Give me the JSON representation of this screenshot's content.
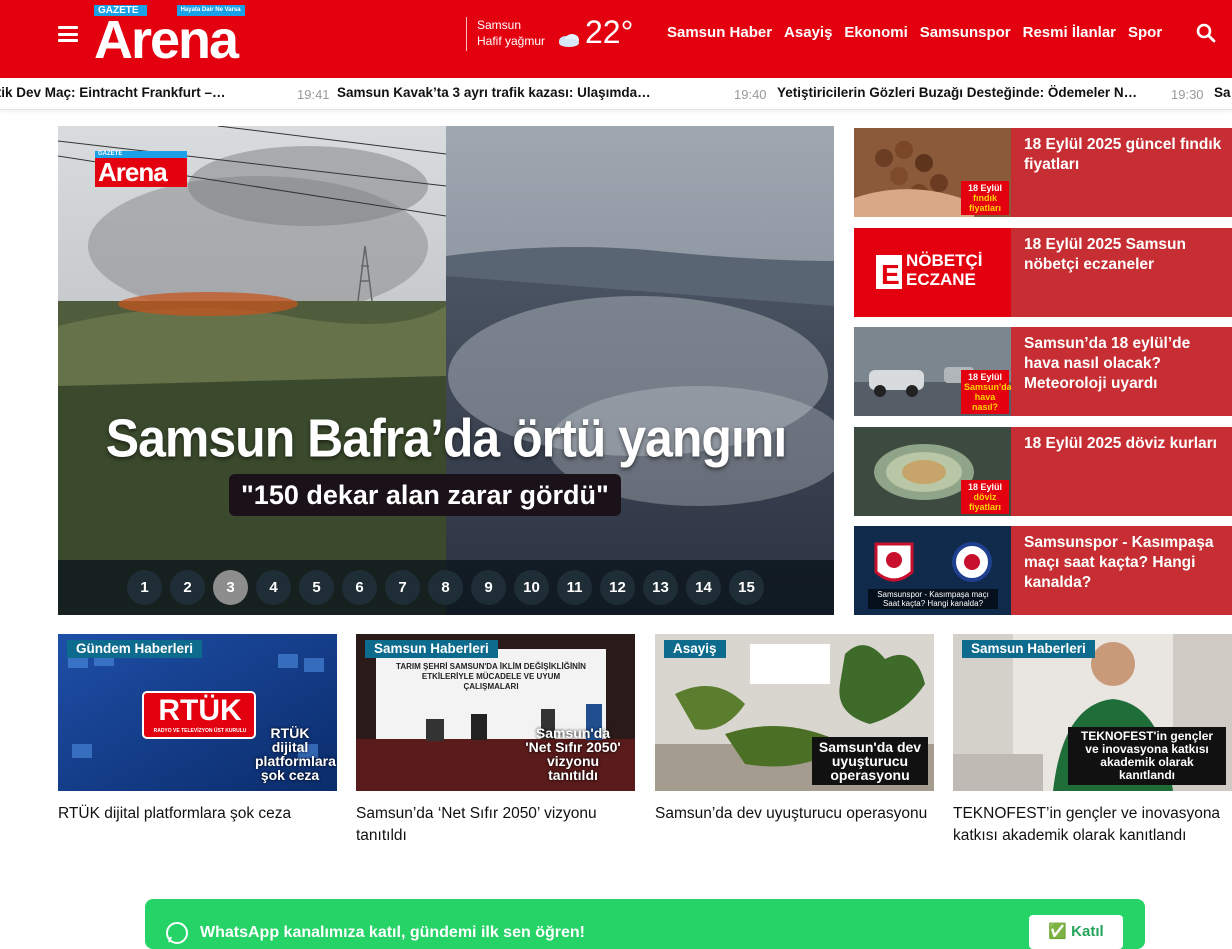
{
  "header": {
    "logo_top": "GAZETE",
    "logo_slogan": "Hayata Dair Ne Varsa",
    "logo_main": "Arena",
    "weather": {
      "city": "Samsun",
      "desc": "Hafif yağmur",
      "temp": "22°"
    },
    "nav": [
      "Samsun Haber",
      "Asayiş",
      "Ekonomi",
      "Samsunspor",
      "Resmi İlanlar",
      "Spor"
    ]
  },
  "ticker": [
    {
      "text": "Kritik Dev Maç: Eintracht Frankfurt –…",
      "time": "19:41"
    },
    {
      "text": "Samsun Kavak’ta 3 ayrı trafik kazası: Ulaşımda…",
      "time": "19:40"
    },
    {
      "text": "Yetiştiricilerin Gözleri Buzağı Desteğinde: Ödemeler N…",
      "time": "19:30"
    },
    {
      "text": "Sa",
      "time": ""
    }
  ],
  "hero": {
    "logo_top": "GAZETE",
    "logo_main": "Arena",
    "title": "Samsun Bafra’da örtü yangını",
    "subtitle": "\"150 dekar alan zarar gördü\"",
    "pages": [
      "1",
      "2",
      "3",
      "4",
      "5",
      "6",
      "7",
      "8",
      "9",
      "10",
      "11",
      "12",
      "13",
      "14",
      "15"
    ],
    "active_page": 3
  },
  "side": [
    {
      "title": "18 Eylül 2025 güncel fındık fiyatları",
      "badge_top": "18 Eylül",
      "badge_bottom": "fındık fiyatları"
    },
    {
      "title": "18 Eylül 2025 Samsun nöbetçi eczaneler",
      "badge_top": "NÖBETÇİ",
      "badge_bottom": "ECZANE"
    },
    {
      "title": "Samsun’da 18 eylül’de hava nasıl olacak? Meteoroloji uyardı",
      "badge_top": "18 Eylül",
      "badge_bottom": "Samsun'da hava nasıl?"
    },
    {
      "title": "18 Eylül 2025 döviz kurları",
      "badge_top": "18 Eylül",
      "badge_bottom": "döviz fiyatları"
    },
    {
      "title": "Samsunspor - Kasımpaşa maçı saat kaçta? Hangi kanalda?",
      "badge_top": "Samsunspor - Kasımpaşa maçı",
      "badge_bottom": "Saat kaçta? Hangi kanalda?"
    }
  ],
  "cards": [
    {
      "category": "Gündem Haberleri",
      "caption": "RTÜK dijital platformlara şok ceza",
      "title": "RTÜK dijital platformlara şok ceza"
    },
    {
      "category": "Samsun Haberleri",
      "caption": "Samsun'da 'Net Sıfır 2050' vizyonu tanıtıldı",
      "title": "Samsun’da ‘Net Sıfır 2050’ vizyonu tanıtıldı"
    },
    {
      "category": "Asayiş",
      "caption": "Samsun'da dev uyuşturucu operasyonu",
      "title": "Samsun’da dev uyuşturucu operasyonu"
    },
    {
      "category": "Samsun Haberleri",
      "caption": "TEKNOFEST'in gençler ve inovasyona katkısı akademik olarak kanıtlandı",
      "title": "TEKNOFEST’in gençler ve inovasyona katkısı akademik olarak kanıtlandı"
    }
  ],
  "card_extra": {
    "rtuk_logo": "RTÜK",
    "rtuk_sub": "RADYO VE TELEVİZYON ÜST KURULU",
    "screen_title": "TARIM ŞEHRİ SAMSUN'DA İKLİM DEĞİŞİKLİĞİNİN ETKİLERİYLE MÜCADELE VE UYUM ÇALIŞMALARI"
  },
  "whatsapp": {
    "text": "WhatsApp kanalımıza katıl, gündemi ilk sen öğren!",
    "button": "✅ Katıl"
  },
  "colors": {
    "brand_red": "#e3000f",
    "side_red": "#c72e33",
    "category_blue": "#0d6b8e",
    "whatsapp_green": "#25d366"
  }
}
